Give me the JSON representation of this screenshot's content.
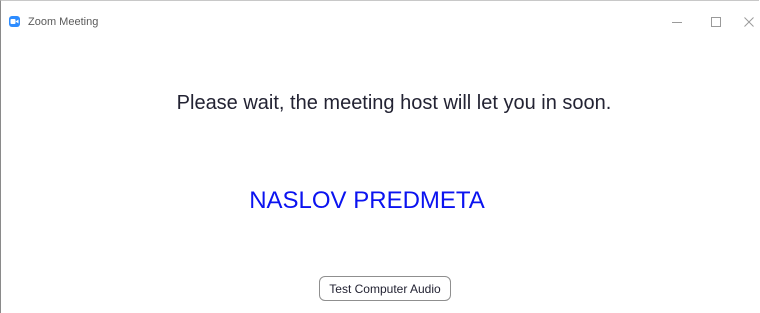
{
  "window": {
    "title": "Zoom Meeting",
    "app_icon": "zoom-camera-icon",
    "controls": [
      "minimize-icon",
      "maximize-icon",
      "close-icon"
    ]
  },
  "main": {
    "wait_message": "Please wait, the meeting host will let you in soon.",
    "meeting_topic": "NASLOV PREDMETA",
    "test_audio_label": "Test Computer Audio"
  },
  "colors": {
    "topic_text": "#0b13f0",
    "body_text": "#232333",
    "zoom_blue": "#2d8cff"
  }
}
